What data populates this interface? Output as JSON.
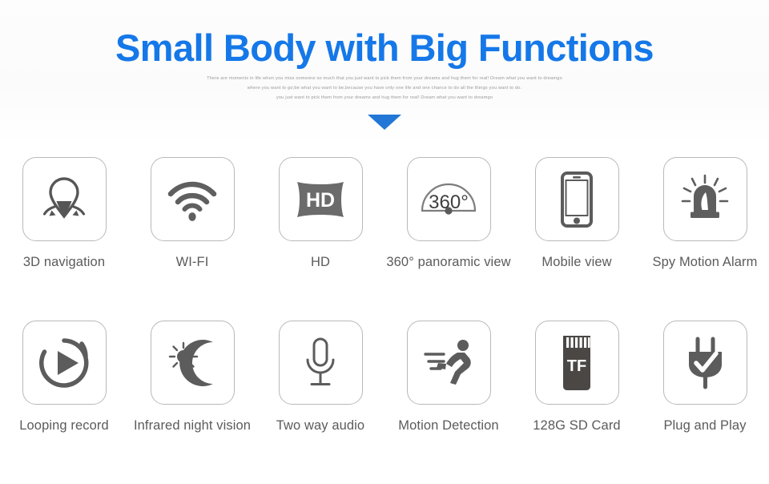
{
  "header": {
    "title": "Small Body with Big Functions",
    "paragraph_lines": [
      "There are moments in life when you miss someone so much that you just want to pick them from your dreams and hug them for real! Dream what you want to dreamgo",
      "where you want to go;be what you want to be,because you have only one life and one chance to do all the things you want to do.",
      "you just want to pick them from your dreams and hug them for real! Dream what you want to dreamgo"
    ],
    "arrow_icon": "chevron-down-triangle-icon",
    "title_color": "#1578E8",
    "arrow_color": "#2277D6"
  },
  "features": [
    {
      "label": "3D navigation",
      "icon": "location-pin-rotate-icon"
    },
    {
      "label": "WI-FI",
      "icon": "wifi-icon"
    },
    {
      "label": "HD",
      "icon": "hd-badge-icon",
      "badge_text": "HD"
    },
    {
      "label": "360° panoramic view",
      "icon": "panorama-360-icon",
      "badge_text": "360°"
    },
    {
      "label": "Mobile view",
      "icon": "smartphone-icon"
    },
    {
      "label": "Spy Motion Alarm",
      "icon": "siren-alarm-icon"
    },
    {
      "label": "Looping record",
      "icon": "loop-play-icon"
    },
    {
      "label": "Infrared night vision",
      "icon": "sun-moon-night-icon"
    },
    {
      "label": "Two way audio",
      "icon": "microphone-icon"
    },
    {
      "label": "Motion Detection",
      "icon": "running-person-icon"
    },
    {
      "label": "128G  SD Card",
      "icon": "tf-memory-card-icon",
      "badge_text": "TF"
    },
    {
      "label": "Plug and Play",
      "icon": "power-plug-check-icon"
    }
  ],
  "colors": {
    "icon_dark": "#565656",
    "icon_gray": "#6f6f6f",
    "tile_border": "#b9b9b9",
    "label_text": "#5b5b5b",
    "card_contacts": "#ffffff"
  }
}
